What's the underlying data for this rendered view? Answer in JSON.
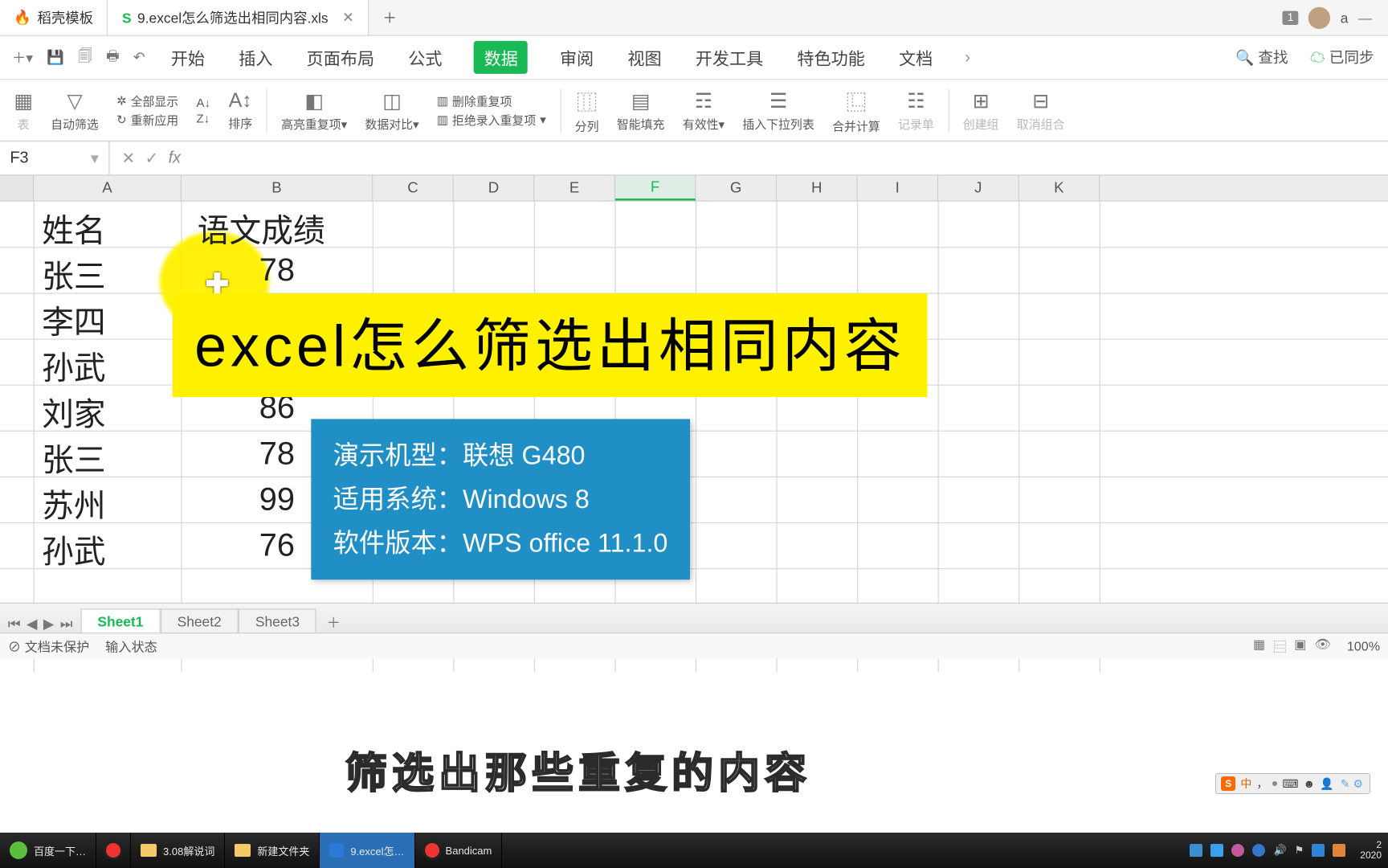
{
  "doctabs": {
    "template": "稻壳模板",
    "file": "9.excel怎么筛选出相同内容.xls",
    "badge": "1",
    "user": "a"
  },
  "menu": {
    "tabs": [
      "开始",
      "插入",
      "页面布局",
      "公式",
      "数据",
      "审阅",
      "视图",
      "开发工具",
      "特色功能",
      "文档"
    ],
    "current": "数据",
    "find": "查找",
    "sync": "已同步"
  },
  "ribbon": {
    "pivotLabel": "表",
    "autoFilter": "自动筛选",
    "showAll": "全部显示",
    "reapply": "重新应用",
    "sortAsc": "A↓Z",
    "sort": "排序",
    "highlight": "高亮重复项",
    "compare": "数据对比",
    "delDup": "删除重复项",
    "rejectDup": "拒绝录入重复项",
    "splitCol": "分列",
    "smartFill": "智能填充",
    "validity": "有效性",
    "dropList": "插入下拉列表",
    "consolidate": "合并计算",
    "record": "记录单",
    "createGrp": "创建组",
    "ungroup": "取消组合"
  },
  "cellref": "F3",
  "columns": [
    "A",
    "B",
    "C",
    "D",
    "E",
    "F",
    "G",
    "H",
    "I",
    "J",
    "K"
  ],
  "chart_data": {
    "type": "table",
    "headers": [
      "姓名",
      "语文成绩"
    ],
    "rows": [
      {
        "name": "张三",
        "score": 78
      },
      {
        "name": "李四",
        "score": null
      },
      {
        "name": "孙武",
        "score": null
      },
      {
        "name": "刘家",
        "score": 86
      },
      {
        "name": "张三",
        "score": 78
      },
      {
        "name": "苏州",
        "score": 99
      },
      {
        "name": "孙武",
        "score": 76
      }
    ]
  },
  "banner": "excel怎么筛选出相同内容",
  "info": {
    "l1": "演示机型：联想 G480",
    "l2": "适用系统：Windows 8",
    "l3": "软件版本：WPS office 11.1.0"
  },
  "subtitle": "筛选出那些重复的内容",
  "sheets": {
    "tabs": [
      "Sheet1",
      "Sheet2",
      "Sheet3"
    ],
    "current": "Sheet1"
  },
  "status": {
    "protect": "文档未保护",
    "mode": "输入状态",
    "zoom": "100%"
  },
  "taskbar": {
    "baidu": "百度一下…",
    "note": "3.08解说词",
    "folder": "新建文件夹",
    "wps": "9.excel怎…",
    "bandicam": "Bandicam"
  },
  "clock": {
    "time": "2",
    "date": "2020"
  },
  "ime": {
    "zh": "中",
    "punc": "，",
    "cn": "。"
  }
}
